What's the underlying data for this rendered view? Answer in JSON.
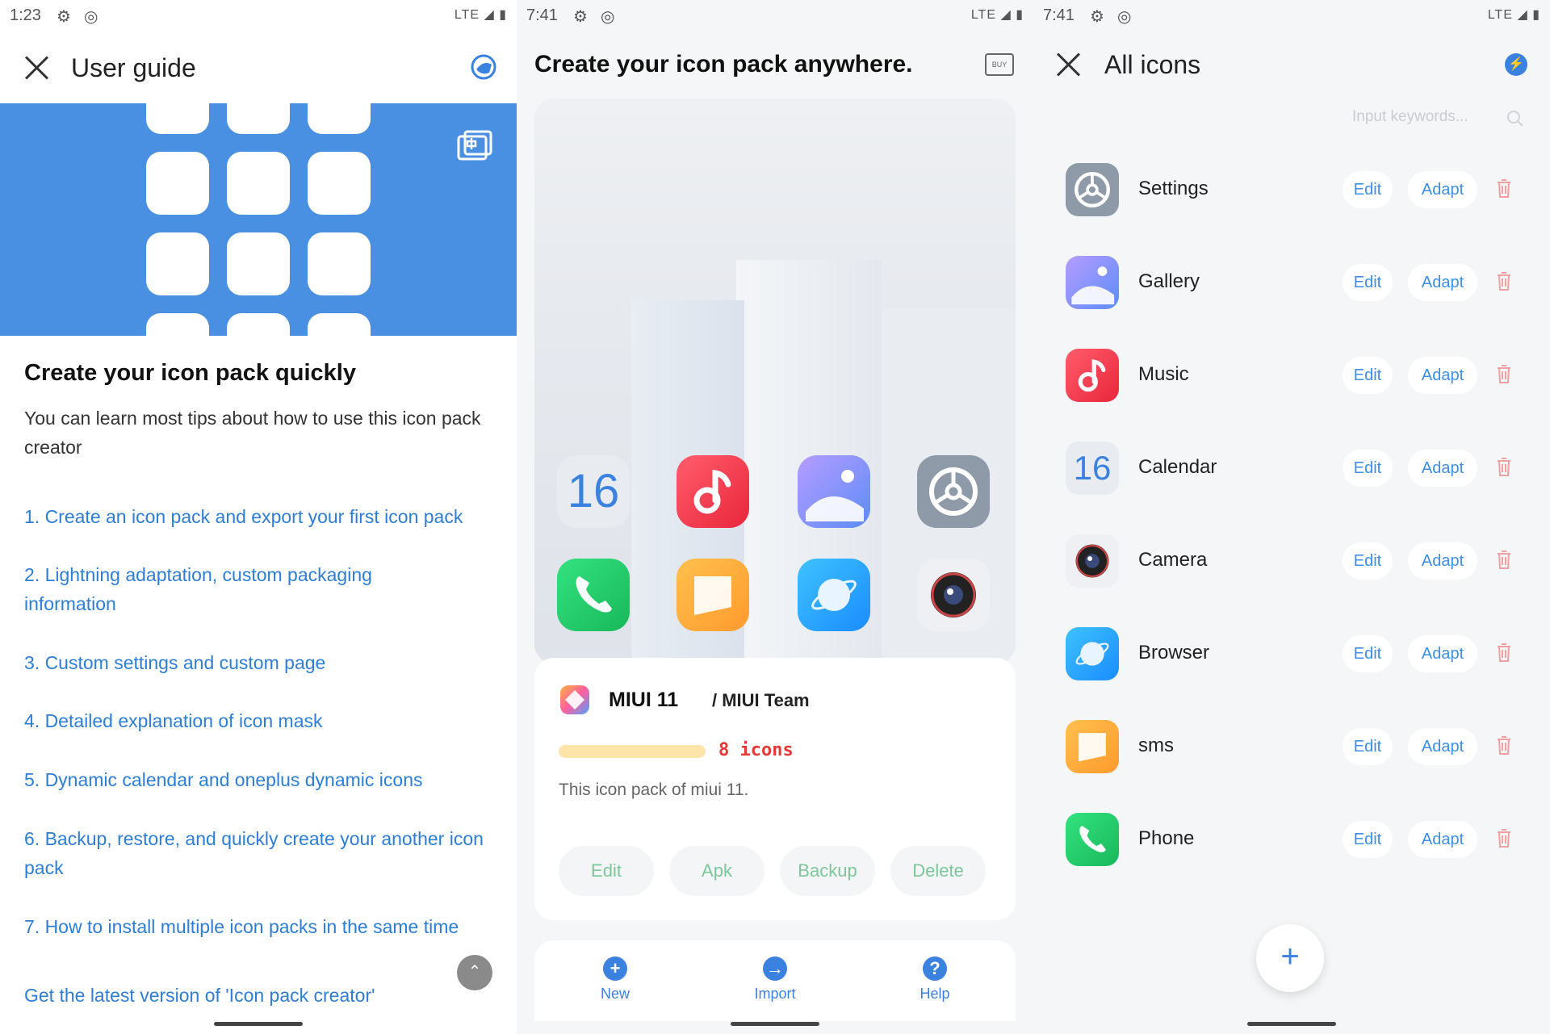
{
  "panel1": {
    "status": {
      "time": "1:23",
      "network": "LTE"
    },
    "title": "User guide",
    "heading": "Create your icon pack quickly",
    "description": "You can learn most tips about how to use this icon pack creator",
    "links": [
      "1. Create an icon pack and export your first icon pack",
      "2. Lightning adaptation, custom packaging information",
      "3. Custom settings and custom page",
      "4. Detailed explanation of icon mask",
      "5. Dynamic calendar and oneplus dynamic icons",
      "6. Backup, restore, and quickly create your another icon pack",
      "7. How to install multiple icon packs in the same time",
      "Get the latest version of 'Icon pack creator'"
    ]
  },
  "panel2": {
    "status": {
      "time": "7:41",
      "network": "LTE"
    },
    "title": "Create your icon pack anywhere.",
    "buy_label": "BUY",
    "calendar_number": "16",
    "pack_name": "MIUI 11",
    "pack_author": "/ MIUI Team",
    "icon_count": "8 icons",
    "icon_progress": 1.0,
    "pack_description": "This icon pack of miui 11.",
    "actions": [
      "Edit",
      "Apk",
      "Backup",
      "Delete"
    ],
    "tabs": [
      "New",
      "Import",
      "Help"
    ]
  },
  "panel3": {
    "status": {
      "time": "7:41",
      "network": "LTE"
    },
    "title": "All icons",
    "search_placeholder": "Input keywords...",
    "calendar_number": "16",
    "edit_label": "Edit",
    "adapt_label": "Adapt",
    "icons": [
      "Settings",
      "Gallery",
      "Music",
      "Calendar",
      "Camera",
      "Browser",
      "sms",
      "Phone"
    ],
    "add_label": "+"
  },
  "colors": {
    "accent_blue": "#4a90e2",
    "link_blue": "#2c7ed6",
    "count_red": "#e53935",
    "progress_yellow": "#fde4a8",
    "pill_text_green": "#7cc79a",
    "trash_red": "#f0a0a0"
  }
}
